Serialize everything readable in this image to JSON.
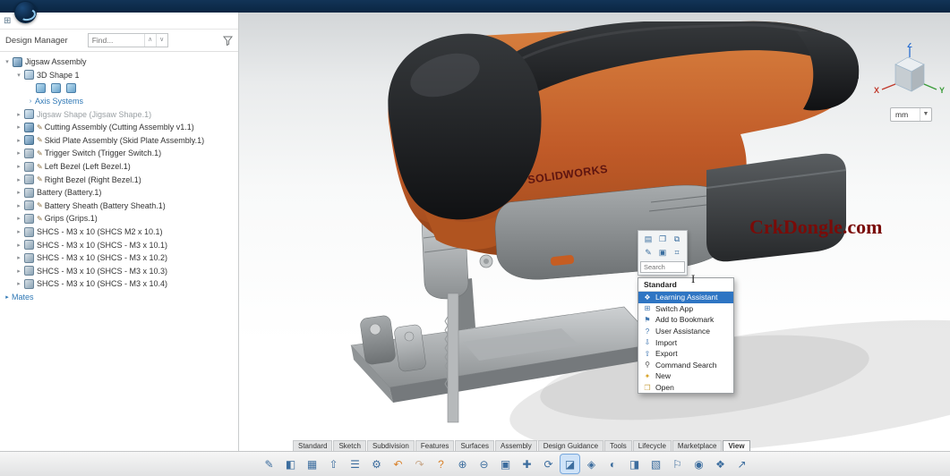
{
  "design_manager": {
    "title": "Design Manager",
    "find_placeholder": "Find...",
    "tree": [
      {
        "label": "Jigsaw Assembly",
        "level": 0,
        "arrow": "▾",
        "icon": "assembly"
      },
      {
        "label": "3D Shape 1",
        "level": 1,
        "arrow": "▾",
        "icon": "shape"
      },
      {
        "label": "",
        "level": 2,
        "badges": true
      },
      {
        "label": "Axis Systems",
        "level": 2,
        "arrow": "›",
        "icon": "none",
        "link": true
      },
      {
        "label": "Jigsaw Shape (Jigsaw Shape.1)",
        "level": 1,
        "arrow": "▸",
        "icon": "shape",
        "muted": true
      },
      {
        "label": "Cutting Assembly (Cutting Assembly v1.1)",
        "level": 1,
        "arrow": "▸",
        "icon": "assembly",
        "pencil": true
      },
      {
        "label": "Skid Plate Assembly (Skid Plate Assembly.1)",
        "level": 1,
        "arrow": "▸",
        "icon": "assembly",
        "pencil": true
      },
      {
        "label": "Trigger Switch (Trigger Switch.1)",
        "level": 1,
        "arrow": "▸",
        "icon": "part",
        "pencil": true
      },
      {
        "label": "Left Bezel (Left Bezel.1)",
        "level": 1,
        "arrow": "▸",
        "icon": "part",
        "pencil": true
      },
      {
        "label": "Right Bezel (Right Bezel.1)",
        "level": 1,
        "arrow": "▸",
        "icon": "part",
        "pencil": true
      },
      {
        "label": "Battery (Battery.1)",
        "level": 1,
        "arrow": "▸",
        "icon": "part"
      },
      {
        "label": "Battery Sheath (Battery Sheath.1)",
        "level": 1,
        "arrow": "▸",
        "icon": "part",
        "pencil": true
      },
      {
        "label": "Grips (Grips.1)",
        "level": 1,
        "arrow": "▸",
        "icon": "part",
        "pencil": true
      },
      {
        "label": "SHCS - M3 x 10 (SHCS M2 x 10.1)",
        "level": 1,
        "arrow": "▸",
        "icon": "part"
      },
      {
        "label": "SHCS - M3 x 10 (SHCS - M3 x 10.1)",
        "level": 1,
        "arrow": "▸",
        "icon": "part"
      },
      {
        "label": "SHCS - M3 x 10 (SHCS - M3 x 10.2)",
        "level": 1,
        "arrow": "▸",
        "icon": "part"
      },
      {
        "label": "SHCS - M3 x 10 (SHCS - M3 x 10.3)",
        "level": 1,
        "arrow": "▸",
        "icon": "part"
      },
      {
        "label": "SHCS - M3 x 10 (SHCS - M3 x 10.4)",
        "level": 1,
        "arrow": "▸",
        "icon": "part"
      },
      {
        "label": "Mates",
        "level": 0,
        "arrow": "▸",
        "icon": "none",
        "link": true
      }
    ]
  },
  "viewport": {
    "model_brand_text": "SOLIDWORKS",
    "watermark": "CrkDongle.com",
    "units": "mm",
    "triad": {
      "x": "X",
      "y": "Y",
      "z": "Z"
    }
  },
  "popup": {
    "search_placeholder": "Search",
    "mini_icons": [
      {
        "name": "note-icon",
        "glyph": "▤"
      },
      {
        "name": "book-icon",
        "glyph": "❐"
      },
      {
        "name": "copy-icon",
        "glyph": "⧉"
      },
      {
        "name": "edit-icon",
        "glyph": "✎"
      },
      {
        "name": "layout-icon",
        "glyph": "▣"
      },
      {
        "name": "grid-icon",
        "glyph": "⌗"
      }
    ],
    "menu": {
      "header": "Standard",
      "items": [
        {
          "label": "Learning Assistant",
          "glyph": "❖",
          "color": "#d98b2b",
          "selected": true
        },
        {
          "label": "Switch App",
          "glyph": "⊞",
          "color": "#3f76b0"
        },
        {
          "label": "Add to Bookmark",
          "glyph": "⚑",
          "color": "#3f76b0"
        },
        {
          "label": "User Assistance",
          "glyph": "?",
          "color": "#3f76b0"
        },
        {
          "label": "Import",
          "glyph": "⇩",
          "color": "#3f76b0"
        },
        {
          "label": "Export",
          "glyph": "⇧",
          "color": "#3f76b0"
        },
        {
          "label": "Command Search",
          "glyph": "⚲",
          "color": "#555555"
        },
        {
          "label": "New",
          "glyph": "✦",
          "color": "#d9a52b"
        },
        {
          "label": "Open",
          "glyph": "❒",
          "color": "#caa44a"
        }
      ]
    }
  },
  "tabs": {
    "items": [
      {
        "label": "Standard"
      },
      {
        "label": "Sketch"
      },
      {
        "label": "Subdivision"
      },
      {
        "label": "Features"
      },
      {
        "label": "Surfaces"
      },
      {
        "label": "Assembly"
      },
      {
        "label": "Design Guidance"
      },
      {
        "label": "Tools"
      },
      {
        "label": "Lifecycle"
      },
      {
        "label": "Marketplace"
      },
      {
        "label": "View",
        "active": true
      }
    ]
  },
  "toolbar": {
    "icons": [
      {
        "name": "sketch-icon",
        "glyph": "✎"
      },
      {
        "name": "shapes-icon",
        "glyph": "◧"
      },
      {
        "name": "save-icon",
        "glyph": "▦"
      },
      {
        "name": "export-icon",
        "glyph": "⇧"
      },
      {
        "name": "properties-icon",
        "glyph": "☰"
      },
      {
        "name": "settings-gear-icon",
        "glyph": "⚙"
      },
      {
        "name": "undo-icon",
        "glyph": "↶",
        "accent": "#d9822b"
      },
      {
        "name": "redo-icon",
        "glyph": "↷",
        "accent": "#c9a98c"
      },
      {
        "name": "help-icon",
        "glyph": "?",
        "accent": "#d9822b"
      },
      {
        "name": "zoom-in-icon",
        "glyph": "⊕"
      },
      {
        "name": "zoom-out-icon",
        "glyph": "⊖"
      },
      {
        "name": "zoom-fit-icon",
        "glyph": "▣"
      },
      {
        "name": "pan-icon",
        "glyph": "✚"
      },
      {
        "name": "rotate-view-icon",
        "glyph": "⟳"
      },
      {
        "name": "section-view-icon",
        "glyph": "◪",
        "active": true
      },
      {
        "name": "display-style-icon",
        "glyph": "◈"
      },
      {
        "name": "hide-show-icon",
        "glyph": "◐"
      },
      {
        "name": "appearance-icon",
        "glyph": "◨"
      },
      {
        "name": "scene-icon",
        "glyph": "▧"
      },
      {
        "name": "flag-icon",
        "glyph": "⚐"
      },
      {
        "name": "focus-icon",
        "glyph": "◉"
      },
      {
        "name": "components-icon",
        "glyph": "❖"
      },
      {
        "name": "share-icon",
        "glyph": "↗"
      }
    ]
  },
  "colors": {
    "body_orange": "#c05a28",
    "menu_highlight_blue": "#2e75c3",
    "watermark_red": "#7a0b08",
    "axis_x_red": "#c0392b",
    "axis_y_green": "#3a9c3a",
    "axis_z_blue": "#2a6fd1"
  }
}
